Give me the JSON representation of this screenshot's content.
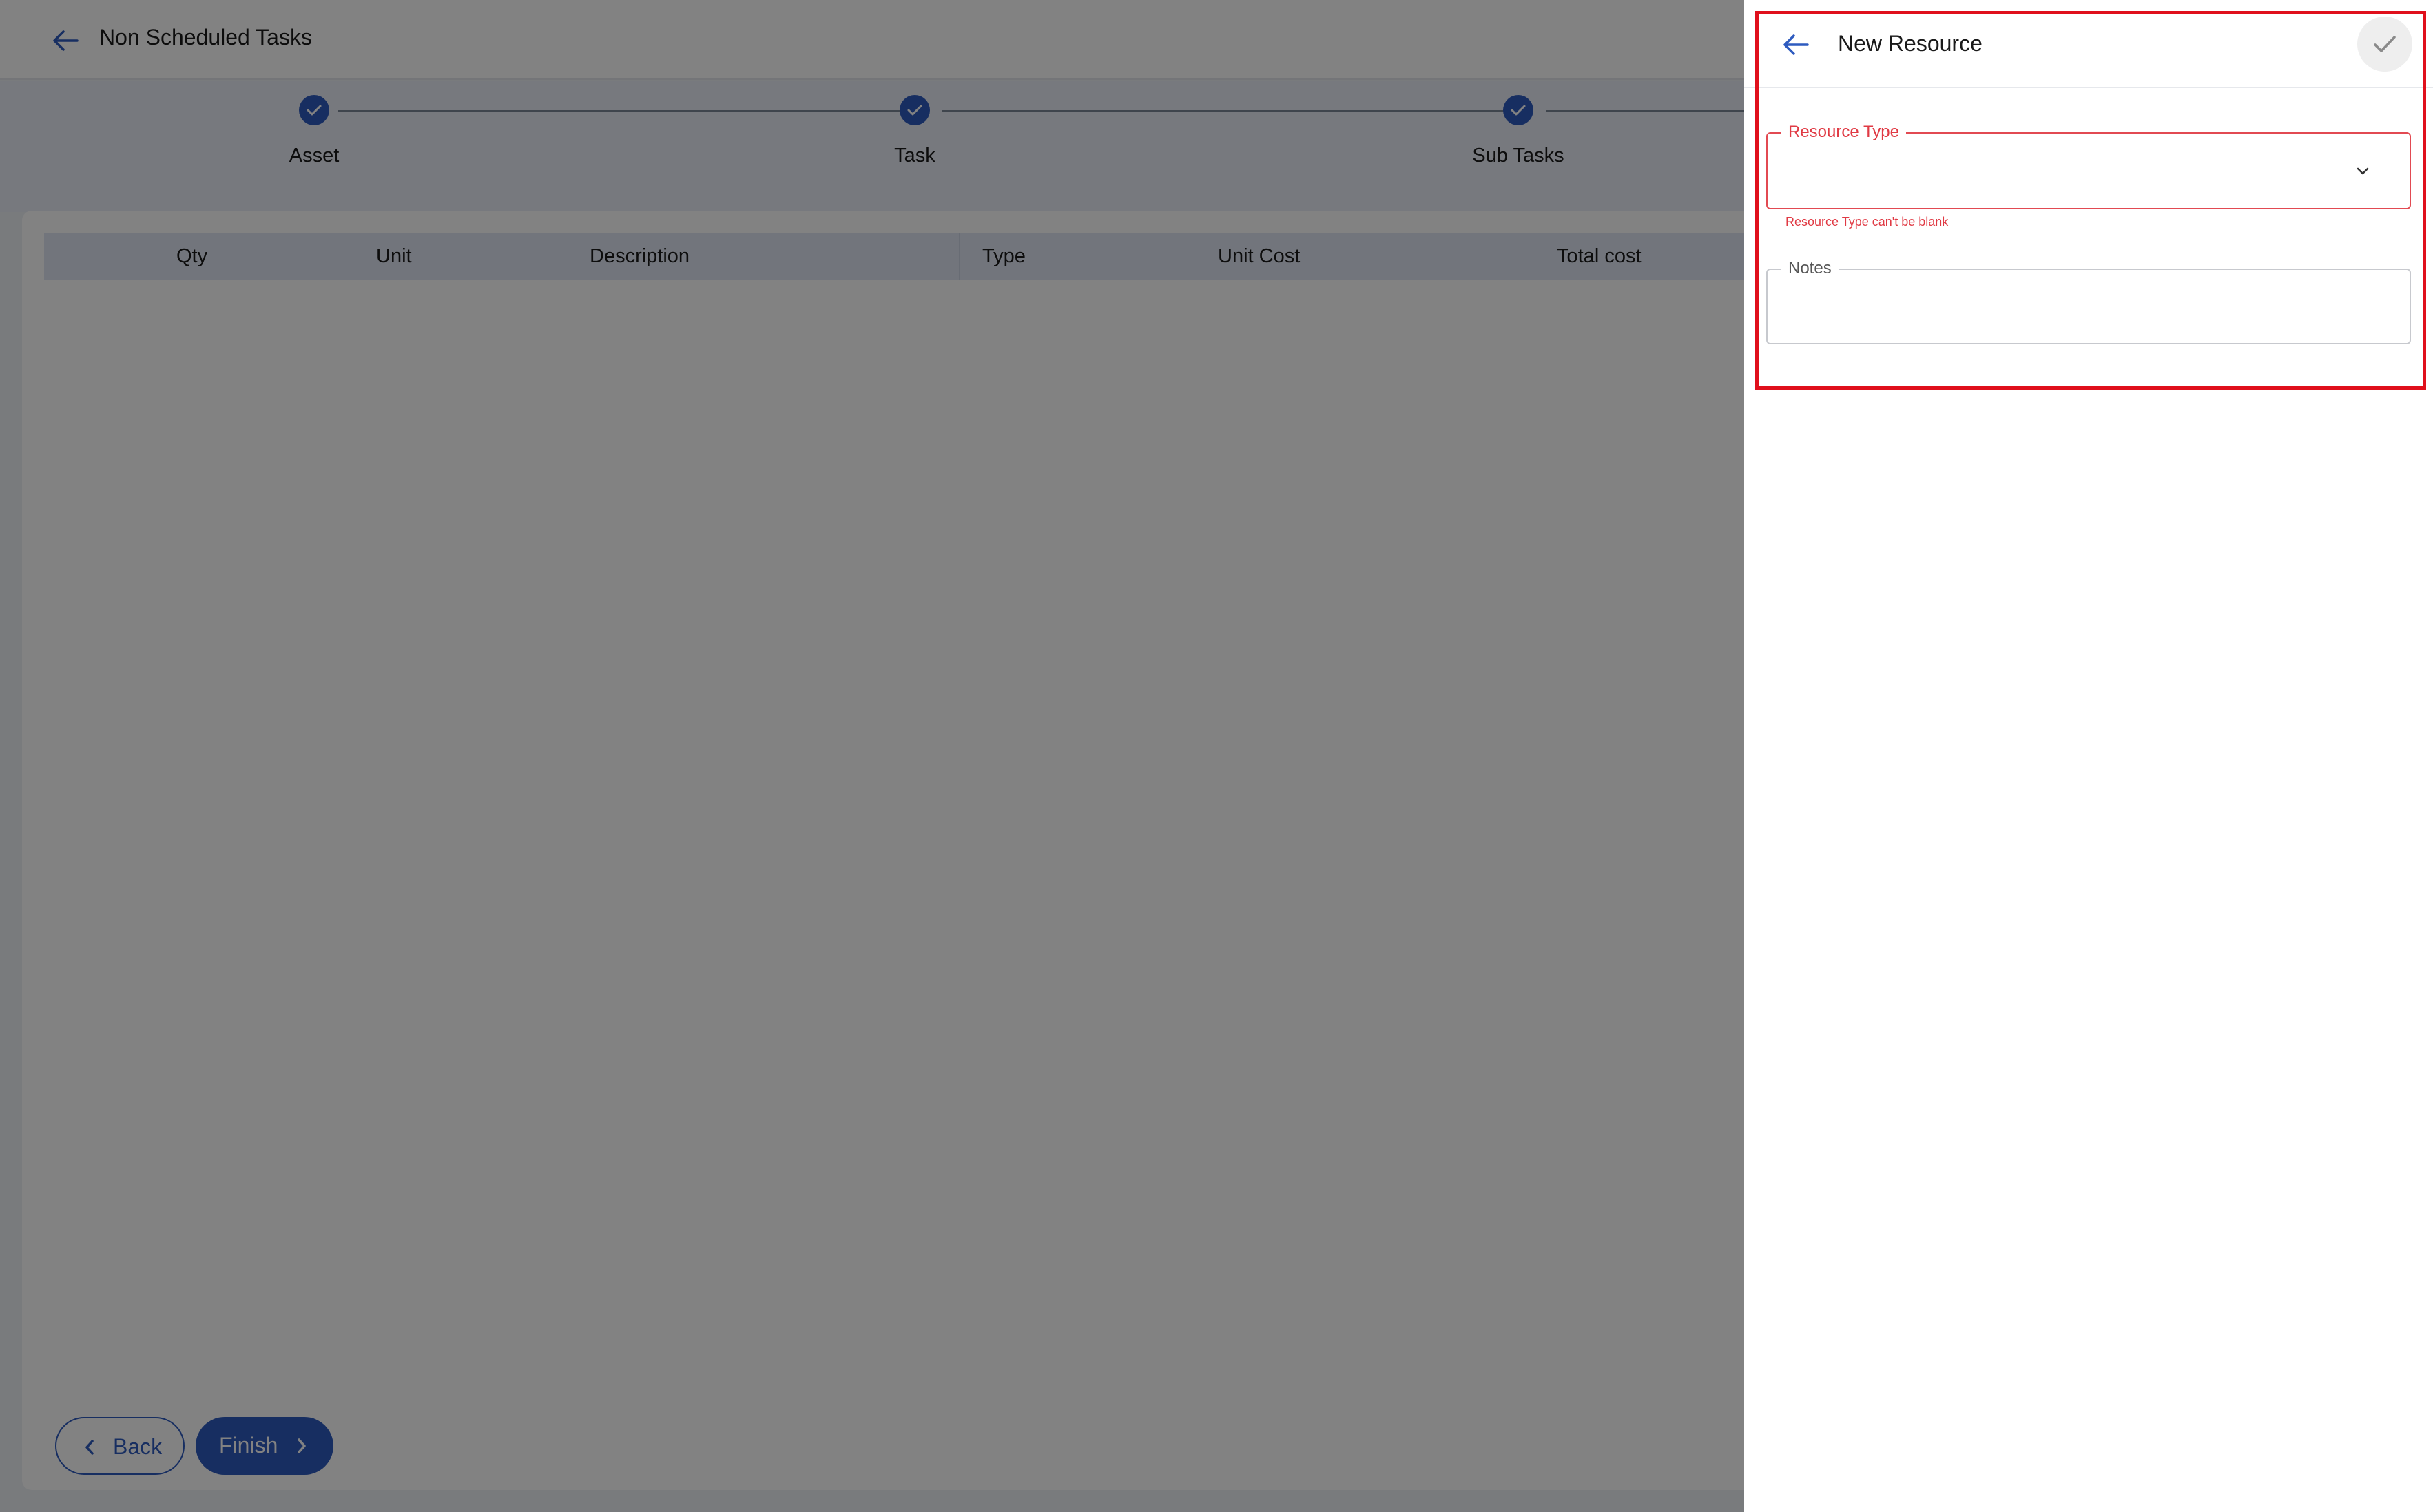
{
  "header": {
    "title": "Non Scheduled Tasks",
    "back_icon": "arrow-left-icon"
  },
  "stepper": {
    "steps": [
      {
        "label": "Asset",
        "status": "complete"
      },
      {
        "label": "Task",
        "status": "complete"
      },
      {
        "label": "Sub Tasks",
        "status": "complete"
      }
    ]
  },
  "table": {
    "columns": [
      "Qty",
      "Unit",
      "Description",
      "Type",
      "Unit Cost",
      "Total cost"
    ],
    "rows": []
  },
  "footer": {
    "back_label": "Back",
    "finish_label": "Finish"
  },
  "panel": {
    "title": "New Resource",
    "resource_type": {
      "label": "Resource Type",
      "value": "",
      "error": "Resource Type can't be blank"
    },
    "notes": {
      "label": "Notes",
      "value": ""
    }
  },
  "colors": {
    "primary": "#2e5bbf",
    "error": "#e03a44",
    "highlight": "#e0101c"
  }
}
